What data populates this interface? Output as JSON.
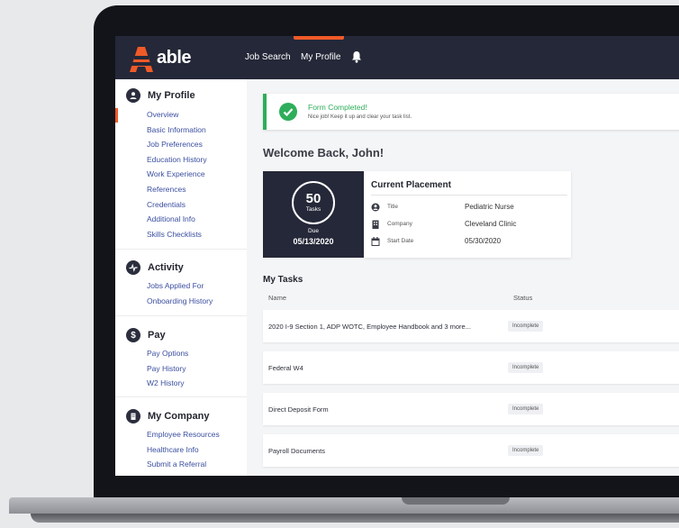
{
  "header": {
    "logo_text": "able",
    "nav": [
      "Job Search",
      "My Profile"
    ]
  },
  "sidebar": {
    "sections": [
      {
        "title": "My Profile",
        "icon": "person-icon",
        "links": [
          "Overview",
          "Basic Information",
          "Job Preferences",
          "Education History",
          "Work Experience",
          "References",
          "Credentials",
          "Additional Info",
          "Skills Checklists"
        ]
      },
      {
        "title": "Activity",
        "icon": "pulse-icon",
        "links": [
          "Jobs Applied For",
          "Onboarding History"
        ]
      },
      {
        "title": "Pay",
        "icon": "dollar-icon",
        "links": [
          "Pay Options",
          "Pay History",
          "W2 History"
        ]
      },
      {
        "title": "My Company",
        "icon": "building-icon",
        "links": [
          "Employee Resources",
          "Healthcare Info",
          "Submit a Referral"
        ]
      }
    ]
  },
  "toast": {
    "title": "Form Completed!",
    "subtitle": "Nice job! Keep it up and clear your task list."
  },
  "welcome": "Welcome Back, John!",
  "due_card": {
    "count": "50",
    "count_label": "Tasks",
    "due_label": "Due",
    "due_date": "05/13/2020"
  },
  "placement": {
    "title": "Current Placement",
    "rows": [
      {
        "label": "Title",
        "value": "Pediatric Nurse"
      },
      {
        "label": "Company",
        "value": "Cleveland Clinic"
      },
      {
        "label": "Start Date",
        "value": "05/30/2020"
      }
    ]
  },
  "tasks": {
    "title": "My Tasks",
    "columns": [
      "Name",
      "Status"
    ],
    "rows": [
      {
        "name": "2020 I-9 Section 1, ADP WOTC, Employee Handbook and 3 more...",
        "status": "Incomplete"
      },
      {
        "name": "Federal W4",
        "status": "Incomplete"
      },
      {
        "name": "Direct Deposit Form",
        "status": "Incomplete"
      },
      {
        "name": "Payroll Documents",
        "status": "Incomplete"
      }
    ]
  },
  "colors": {
    "brand_orange": "#f05a28",
    "nav_dark": "#252838",
    "success": "#2eae5a",
    "link": "#3b4fa0"
  }
}
